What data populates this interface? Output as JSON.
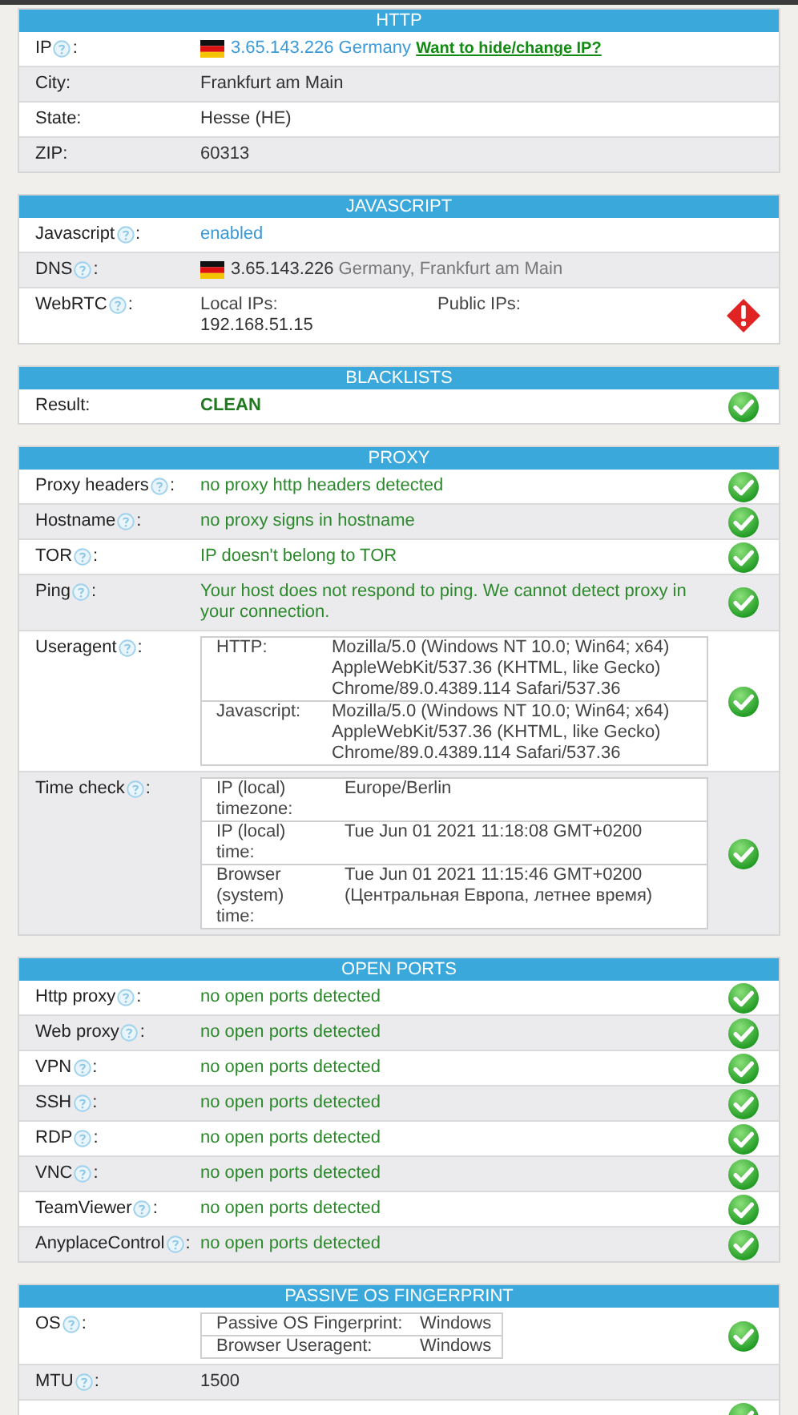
{
  "sections": [
    {
      "title": "HTTP",
      "rows": [
        {
          "kind": "text",
          "label": "IP",
          "label_end": ":",
          "help": true,
          "flag": true,
          "parts": [
            {
              "text": "3.65.143.226 Germany",
              "kind": "info"
            }
          ],
          "link": "Want to hide/change IP?"
        },
        {
          "kind": "text",
          "label": "City:",
          "parts": [
            {
              "text": "Frankfurt am Main",
              "kind": "plain"
            }
          ]
        },
        {
          "kind": "text",
          "label": "State:",
          "parts": [
            {
              "text": "Hesse (HE)",
              "kind": "plain"
            }
          ]
        },
        {
          "kind": "text",
          "label": "ZIP:",
          "parts": [
            {
              "text": "60313",
              "kind": "plain"
            }
          ]
        }
      ]
    },
    {
      "title": "JAVASCRIPT",
      "rows": [
        {
          "kind": "text",
          "label": "Javascript",
          "label_end": ":",
          "help": true,
          "parts": [
            {
              "text": "enabled",
              "kind": "info"
            }
          ]
        },
        {
          "kind": "text",
          "label": "DNS",
          "label_end": ":",
          "help": true,
          "flag": true,
          "parts": [
            {
              "text": "3.65.143.226",
              "kind": "plain"
            },
            {
              "text": "Germany, Frankfurt am Main",
              "kind": "muted"
            }
          ]
        },
        {
          "kind": "webrtc",
          "label": "WebRTC",
          "label_end": ":",
          "help": true,
          "columns": [
            {
              "heading": "Local IPs:",
              "value": "192.168.51.15"
            },
            {
              "heading": "Public IPs:"
            }
          ],
          "warning": true
        }
      ]
    },
    {
      "title": "BLACKLISTS",
      "rows": [
        {
          "kind": "text",
          "label": "Result:",
          "parts": [
            {
              "text": "CLEAN",
              "kind": "good_bold"
            }
          ],
          "check": true
        }
      ]
    },
    {
      "title": "PROXY",
      "rows": [
        {
          "kind": "text",
          "label": "Proxy headers",
          "label_end": ":",
          "help": true,
          "parts": [
            {
              "text": "no proxy http headers detected",
              "kind": "good"
            }
          ],
          "check": true
        },
        {
          "kind": "text",
          "label": "Hostname",
          "label_end": ":",
          "help": true,
          "parts": [
            {
              "text": "no proxy signs in hostname",
              "kind": "good"
            }
          ],
          "check": true
        },
        {
          "kind": "text",
          "label": "TOR",
          "label_end": ":",
          "help": true,
          "parts": [
            {
              "text": "IP doesn't belong to TOR",
              "kind": "good"
            }
          ],
          "check": true
        },
        {
          "kind": "text",
          "label": "Ping",
          "label_end": ":",
          "help": true,
          "parts": [
            {
              "text": "Your host does not respond to ping. We cannot detect proxy in your connection.",
              "kind": "good"
            }
          ],
          "check": true
        },
        {
          "kind": "useragent_table",
          "label": "Useragent",
          "label_end": ":",
          "help": true,
          "entries": [
            {
              "key": "HTTP:",
              "value": "Mozilla/5.0 (Windows NT 10.0; Win64; x64) AppleWebKit/537.36 (KHTML, like Gecko) Chrome/89.0.4389.114 Safari/537.36"
            },
            {
              "key": "Javascript:",
              "value": "Mozilla/5.0 (Windows NT 10.0; Win64; x64) AppleWebKit/537.36 (KHTML, like Gecko) Chrome/89.0.4389.114 Safari/537.36"
            }
          ],
          "check": true
        },
        {
          "kind": "time_table",
          "label": "Time check",
          "label_end": ":",
          "help": true,
          "entries": [
            {
              "key": "IP (local) timezone:",
              "value": "Europe/Berlin"
            },
            {
              "key": "IP (local) time:",
              "value": "Tue Jun 01 2021 11:18:08 GMT+0200"
            },
            {
              "key": "Browser (system) time:",
              "value": "Tue Jun 01 2021 11:15:46 GMT+0200 (Центральная Европа, летнее время)"
            }
          ],
          "check": true
        }
      ]
    },
    {
      "title": "OPEN PORTS",
      "rows": [
        {
          "kind": "text",
          "label": "Http proxy",
          "label_end": ":",
          "help": true,
          "parts": [
            {
              "text": "no open ports detected",
              "kind": "good"
            }
          ],
          "check": true
        },
        {
          "kind": "text",
          "label": "Web proxy",
          "label_end": ":",
          "help": true,
          "parts": [
            {
              "text": "no open ports detected",
              "kind": "good"
            }
          ],
          "check": true
        },
        {
          "kind": "text",
          "label": "VPN",
          "label_end": ":",
          "help": true,
          "parts": [
            {
              "text": "no open ports detected",
              "kind": "good"
            }
          ],
          "check": true
        },
        {
          "kind": "text",
          "label": "SSH",
          "label_end": ":",
          "help": true,
          "parts": [
            {
              "text": "no open ports detected",
              "kind": "good"
            }
          ],
          "check": true
        },
        {
          "kind": "text",
          "label": "RDP",
          "label_end": ":",
          "help": true,
          "parts": [
            {
              "text": "no open ports detected",
              "kind": "good"
            }
          ],
          "check": true
        },
        {
          "kind": "text",
          "label": "VNC",
          "label_end": ":",
          "help": true,
          "parts": [
            {
              "text": "no open ports detected",
              "kind": "good"
            }
          ],
          "check": true
        },
        {
          "kind": "text",
          "label": "TeamViewer",
          "label_end": ":",
          "help": true,
          "parts": [
            {
              "text": "no open ports detected",
              "kind": "good"
            }
          ],
          "check": true
        },
        {
          "kind": "text",
          "label": "AnyplaceControl",
          "label_end": ":",
          "help": true,
          "parts": [
            {
              "text": "no open ports detected",
              "kind": "good"
            }
          ],
          "check": true
        }
      ]
    },
    {
      "title": "PASSIVE OS FINGERPRINT",
      "rows": [
        {
          "kind": "os_table",
          "label": "OS",
          "label_end": ":",
          "help": true,
          "entries": [
            {
              "key": "Passive OS Fingerprint:",
              "value": "Windows"
            },
            {
              "key": "Browser Useragent:",
              "value": "Windows"
            }
          ],
          "check": true
        },
        {
          "kind": "text",
          "label": "MTU",
          "label_end": ":",
          "help": true,
          "parts": [
            {
              "text": "1500",
              "kind": "plain"
            }
          ]
        },
        {
          "kind": "blank",
          "check": true
        }
      ]
    }
  ]
}
